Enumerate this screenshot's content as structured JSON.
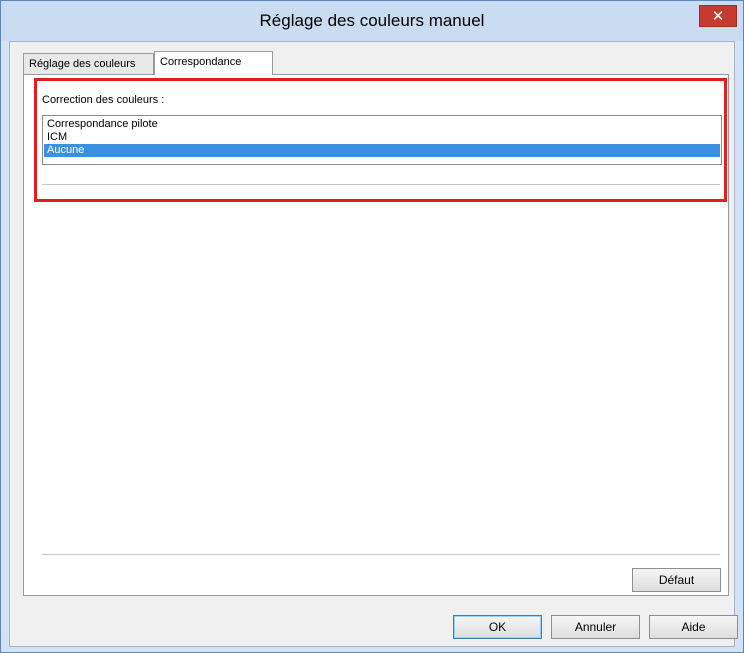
{
  "window": {
    "title": "Réglage des couleurs manuel",
    "close_glyph": "✕"
  },
  "tabs": [
    {
      "label": "Réglage des couleurs",
      "active": false
    },
    {
      "label": "Correspondance",
      "active": true
    }
  ],
  "panel": {
    "label": "Correction des couleurs :",
    "options": [
      "Correspondance pilote",
      "ICM",
      "Aucune"
    ],
    "selected": "Aucune",
    "highlight_color": "#e21f1f"
  },
  "buttons": {
    "defaut": "Défaut",
    "ok": "OK",
    "annuler": "Annuler",
    "aide": "Aide"
  },
  "colors": {
    "selection": "#3b90e0",
    "close": "#c63b2f"
  }
}
